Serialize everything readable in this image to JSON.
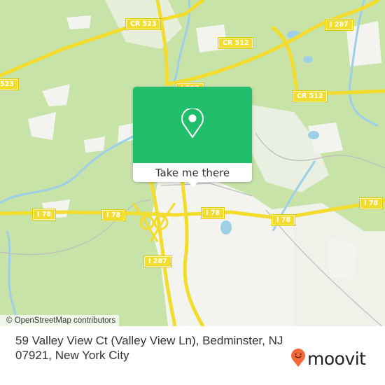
{
  "map": {
    "colors": {
      "land": "#c8e3a8",
      "urban": "#f3f3ef",
      "water": "#9ecfe6",
      "highway": "#f2dc2e",
      "minor_road": "#bdbdbd"
    },
    "road_labels": [
      {
        "id": "cr523-top",
        "text": "CR 523"
      },
      {
        "id": "cr512-top",
        "text": "CR 512"
      },
      {
        "id": "i287-top",
        "text": "I 287"
      },
      {
        "id": "cr512-right",
        "text": "CR 512"
      },
      {
        "id": "cr523-left",
        "text": "523"
      },
      {
        "id": "i287-hidden",
        "text": "I 287"
      },
      {
        "id": "i78-left",
        "text": "I 78"
      },
      {
        "id": "i78-center",
        "text": "I 78"
      },
      {
        "id": "i78-mid",
        "text": "I 78"
      },
      {
        "id": "i78-right",
        "text": "I 78"
      },
      {
        "id": "i78-far-right",
        "text": "I 78"
      },
      {
        "id": "i287-bottom",
        "text": "I 287"
      }
    ],
    "attribution": "© OpenStreetMap contributors"
  },
  "popup": {
    "icon": "map-pin-icon",
    "button_label": "Take me there",
    "color": "#20bd6b"
  },
  "footer": {
    "address": "59 Valley View Ct (Valley View Ln), Bedminster, NJ 07921, New York City",
    "brand": "moovit",
    "brand_icon": "moovit-pin-smile-icon",
    "brand_color": "#f26a3a"
  }
}
